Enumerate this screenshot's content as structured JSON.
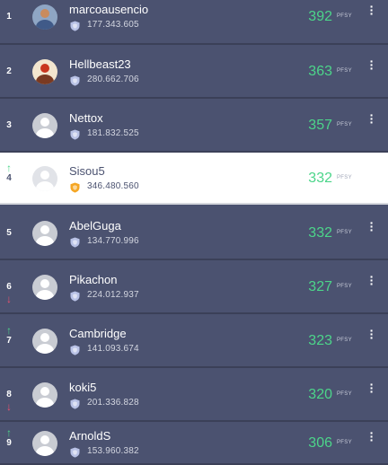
{
  "unit_label": "PFSY",
  "rows": [
    {
      "rank": "1",
      "name": "marcoausencio",
      "points": "177.343.605",
      "score": "392",
      "trend": "none",
      "highlight": false,
      "avatar": "photo1",
      "shield": "blue"
    },
    {
      "rank": "2",
      "name": "Hellbeast23",
      "points": "280.662.706",
      "score": "363",
      "trend": "none",
      "highlight": false,
      "avatar": "photo2",
      "shield": "blue"
    },
    {
      "rank": "3",
      "name": "Nettox",
      "points": "181.832.525",
      "score": "357",
      "trend": "none",
      "highlight": false,
      "avatar": "default",
      "shield": "blue"
    },
    {
      "rank": "4",
      "name": "Sisou5",
      "points": "346.480.560",
      "score": "332",
      "trend": "up",
      "highlight": true,
      "avatar": "default",
      "shield": "gold"
    },
    {
      "rank": "5",
      "name": "AbelGuga",
      "points": "134.770.996",
      "score": "332",
      "trend": "none",
      "highlight": false,
      "avatar": "default",
      "shield": "blue"
    },
    {
      "rank": "6",
      "name": "Pikachon",
      "points": "224.012.937",
      "score": "327",
      "trend": "down",
      "highlight": false,
      "avatar": "default",
      "shield": "blue"
    },
    {
      "rank": "7",
      "name": "Cambridge",
      "points": "141.093.674",
      "score": "323",
      "trend": "up",
      "highlight": false,
      "avatar": "default",
      "shield": "blue"
    },
    {
      "rank": "8",
      "name": "koki5",
      "points": "201.336.828",
      "score": "320",
      "trend": "down",
      "highlight": false,
      "avatar": "default",
      "shield": "blue"
    },
    {
      "rank": "9",
      "name": "ArnoldS",
      "points": "153.960.382",
      "score": "306",
      "trend": "up",
      "highlight": false,
      "avatar": "default",
      "shield": "blue"
    }
  ],
  "icons": {
    "up": "arrow-up-icon",
    "down": "arrow-down-icon",
    "shield": "shield-icon",
    "menu": "more-vertical-icon"
  },
  "colors": {
    "row_bg": "#4b5270",
    "highlight_bg": "#ffffff",
    "score": "#4cd58a",
    "trend_up": "#4cd58a",
    "trend_down": "#f0506e",
    "shield_blue": "#b9c2e6",
    "shield_gold": "#f5a623"
  }
}
